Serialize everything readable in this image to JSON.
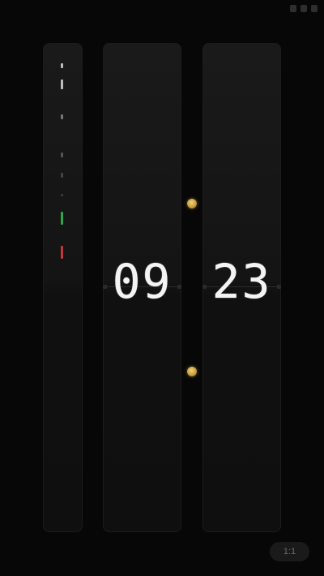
{
  "clock": {
    "hours": "09",
    "minutes": "23"
  },
  "controls": {
    "aspect_ratio_label": "1:1"
  },
  "colors": {
    "background": "#070707",
    "panel": "#161616",
    "digit": "#f4f4f4",
    "knob": "#d4ad4f",
    "side_green": "#2fa64a",
    "side_red": "#c0383a"
  }
}
